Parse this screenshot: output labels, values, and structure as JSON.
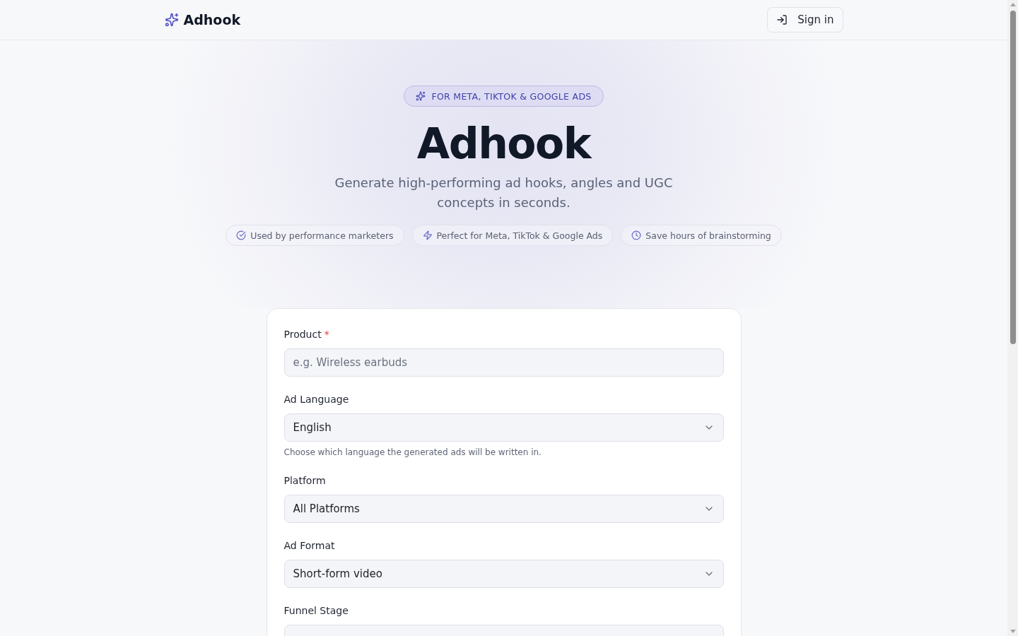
{
  "header": {
    "logo": "Adhook",
    "sign_in": "Sign in"
  },
  "hero": {
    "badge": "FOR META, TIKTOK & GOOGLE ADS",
    "title": "Adhook",
    "subtitle": "Generate high-performing ad hooks, angles and UGC concepts in seconds.",
    "pills": [
      {
        "kind": "check",
        "label": "Used by performance marketers"
      },
      {
        "kind": "bolt",
        "label": "Perfect for Meta, TikTok & Google Ads"
      },
      {
        "kind": "clock",
        "label": "Save hours of brainstorming"
      }
    ]
  },
  "form": {
    "fields": [
      {
        "kind": "text",
        "label": "Product",
        "required_mark": "*",
        "placeholder": "e.g. Wireless earbuds"
      },
      {
        "kind": "select",
        "label": "Ad Language",
        "value": "English",
        "helper": "Choose which language the generated ads will be written in."
      },
      {
        "kind": "select",
        "label": "Platform",
        "value": "All Platforms"
      },
      {
        "kind": "select",
        "label": "Ad Format",
        "value": "Short-form video"
      },
      {
        "kind": "select",
        "label": "Funnel Stage"
      }
    ]
  }
}
